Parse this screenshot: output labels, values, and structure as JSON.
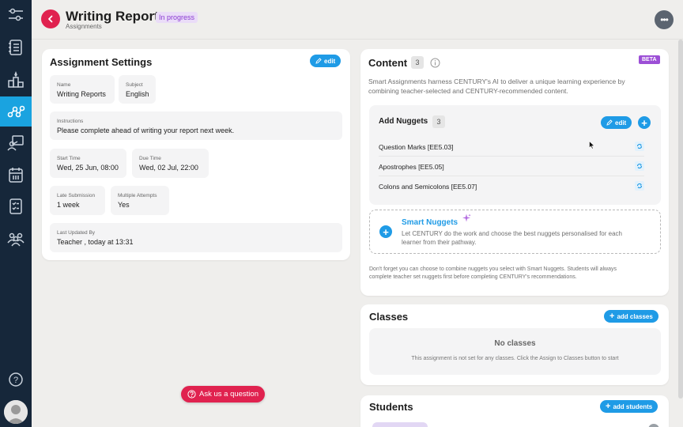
{
  "header": {
    "title": "Writing Reports",
    "status": "In progress",
    "breadcrumb": "Assignments",
    "more_label": "•••"
  },
  "sidebar": {
    "items": [
      {
        "icon": "sliders-icon"
      },
      {
        "icon": "notebook-icon"
      },
      {
        "icon": "chart-podium-icon"
      },
      {
        "icon": "pathway-nodes-icon",
        "active": true
      },
      {
        "icon": "teacher-board-icon"
      },
      {
        "icon": "calendar-icon"
      },
      {
        "icon": "checklist-icon"
      },
      {
        "icon": "users-group-icon"
      }
    ],
    "help_label": "?"
  },
  "settings": {
    "title": "Assignment Settings",
    "edit_label": "edit",
    "name_label": "Name",
    "name_value": "Writing Reports",
    "subject_label": "Subject",
    "subject_value": "English",
    "instructions_label": "Instructions",
    "instructions_value": "Please complete ahead of writing your report next week.",
    "start_label": "Start Time",
    "start_value": "Wed, 25 Jun, 08:00",
    "due_label": "Due Time",
    "due_value": "Wed, 02 Jul, 22:00",
    "late_label": "Late Submission",
    "late_value": "1 week",
    "attempts_label": "Multiple Attempts",
    "attempts_value": "Yes",
    "updated_label": "Last Updated By",
    "updated_value": "Teacher , today at 13:31"
  },
  "content": {
    "title": "Content",
    "count": "3",
    "beta": "BETA",
    "description_1": "Smart Assignments harness CENTURY's AI to deliver a unique learning experience by",
    "description_2": "combining teacher-selected and CENTURY-recommended content.",
    "nuggets_title": "Add Nuggets",
    "nuggets_count": "3",
    "nuggets_edit": "edit",
    "nuggets": [
      "Question Marks [EE5.03]",
      "Apostrophes [EE5.05]",
      "Colons and Semicolons [EE5.07]"
    ],
    "smart_title": "Smart Nuggets",
    "smart_text_1": "Let CENTURY do the work and choose the best nuggets personalised for each",
    "smart_text_2": "learner from their pathway.",
    "footnote_1": "Don't forget you can choose to combine nuggets you select with Smart Nuggets. Students will always",
    "footnote_2": "complete teacher set nuggets first before completing CENTURY's recommendations."
  },
  "classes": {
    "title": "Classes",
    "add_label": "add classes",
    "empty_title": "No classes",
    "empty_text": "This assignment is not set for any classes. Click the Assign to Classes button to start"
  },
  "students": {
    "title": "Students",
    "add_label": "add students"
  },
  "ask": {
    "label": "Ask us a question"
  },
  "colors": {
    "sidebar": "#16273a",
    "accent": "#1f9be6",
    "brand": "#e0224f",
    "status": "#8a3bd1"
  }
}
